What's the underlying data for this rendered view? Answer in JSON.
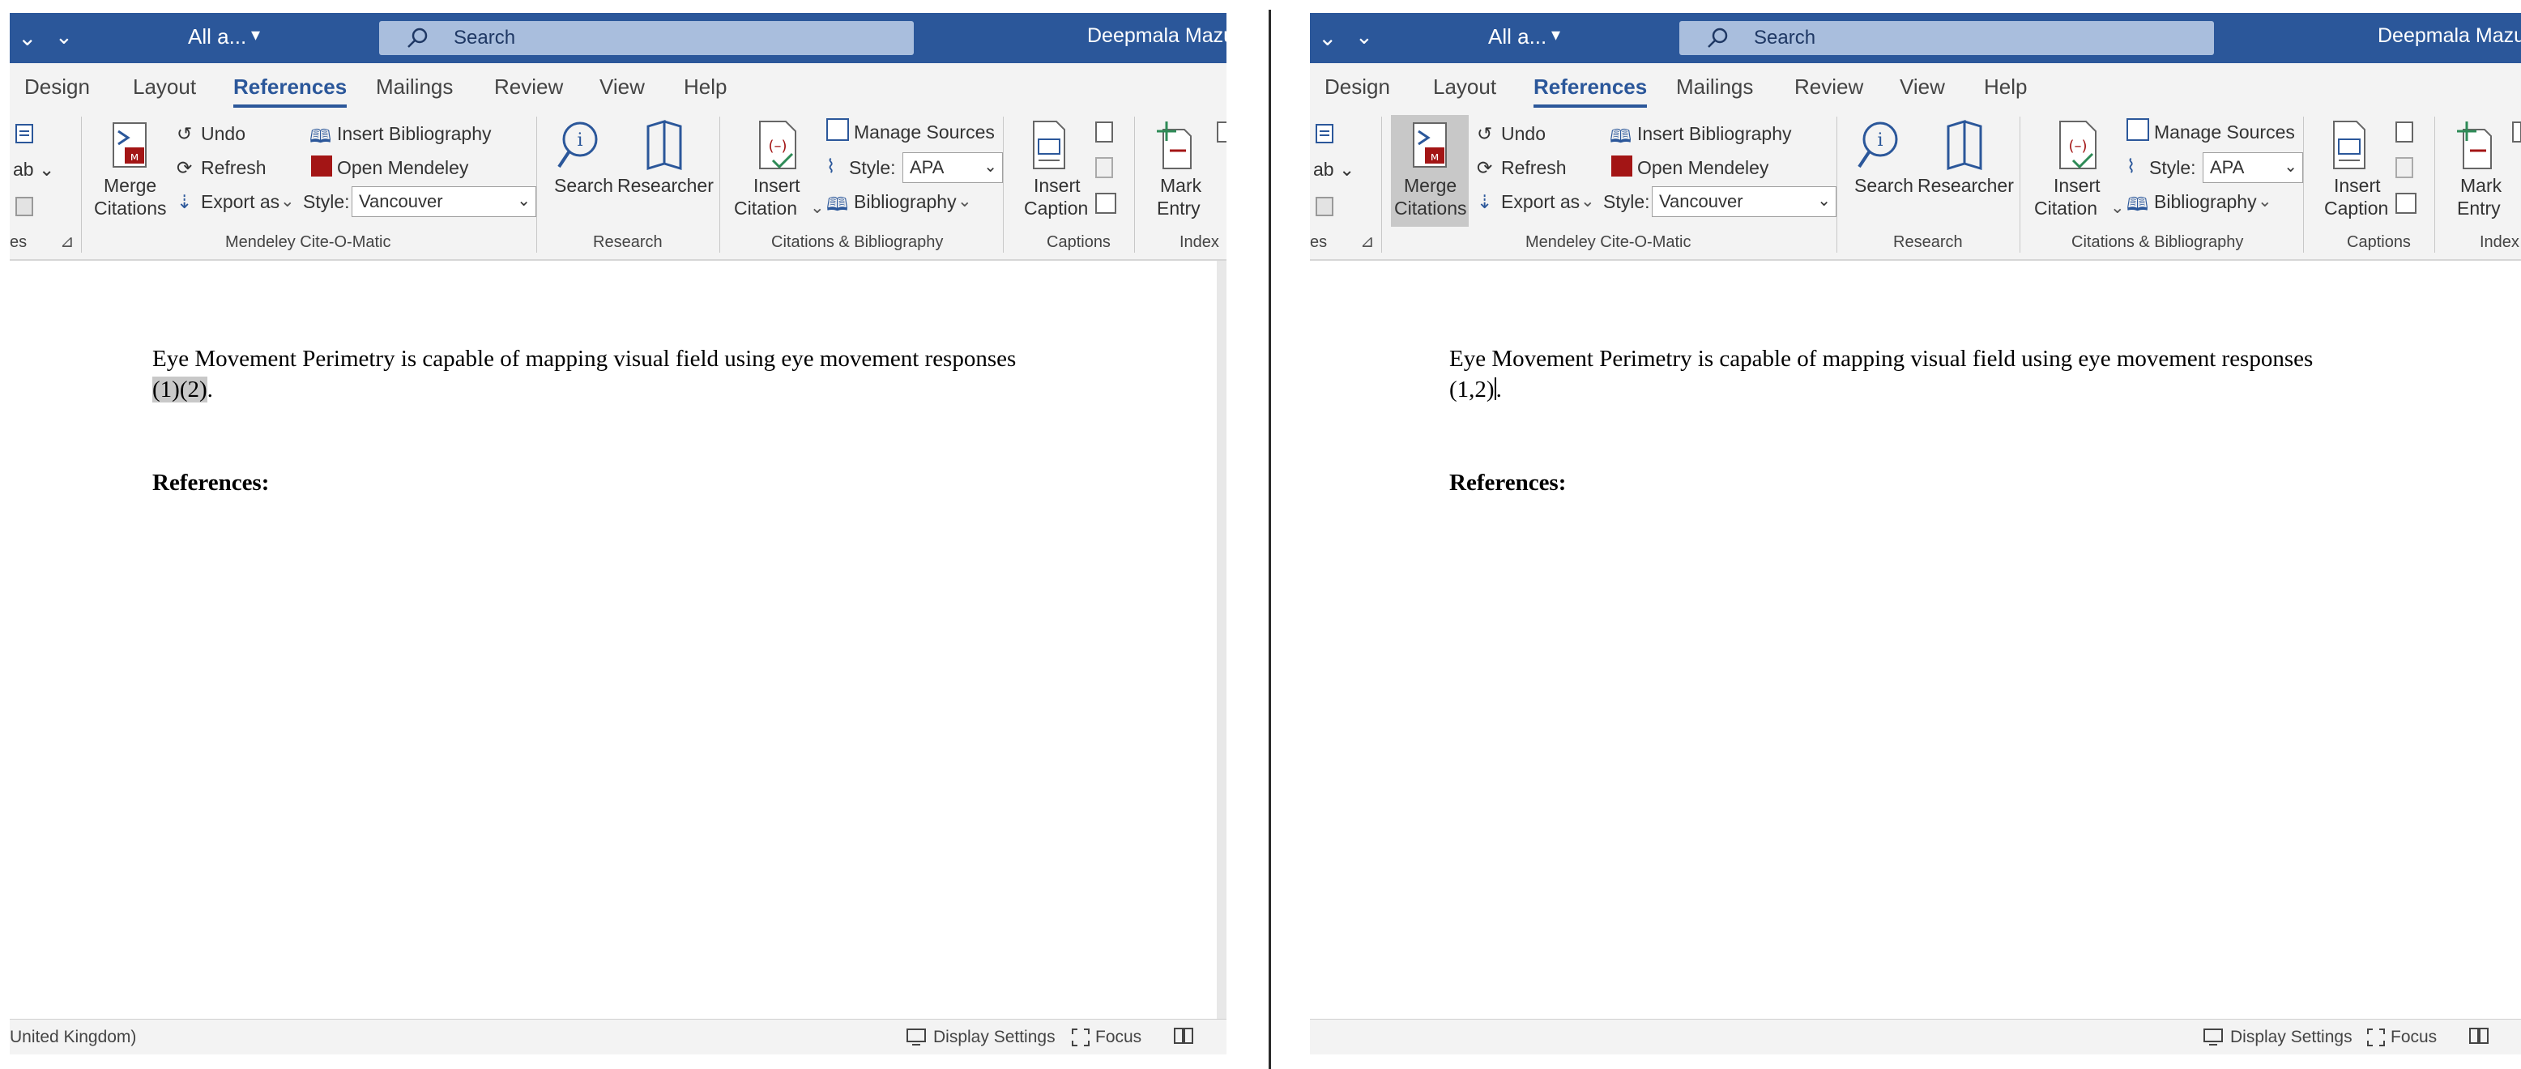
{
  "colors": {
    "titlebar": "#2b579a",
    "search_box": "#a9bedd",
    "ribbon": "#f3f3f3",
    "mendeley_red": "#a31515",
    "accent_blue": "#2b579a"
  },
  "left": {
    "titlebar": {
      "doc_label": "All a...",
      "search_placeholder": "Search",
      "user": "Deepmala Mazum"
    },
    "tabs": [
      "Design",
      "Layout",
      "References",
      "Mailings",
      "Review",
      "View",
      "Help"
    ],
    "active_tab": "References",
    "ribbon": {
      "cut_group_label": "es",
      "merge_citations": [
        "Merge",
        "Citations"
      ],
      "undo": "Undo",
      "refresh": "Refresh",
      "export_as": "Export as",
      "insert_bibliography": "Insert Bibliography",
      "open_mendeley": "Open Mendeley",
      "style_label": "Style:",
      "style_value": "Vancouver",
      "mendeley_group": "Mendeley Cite-O-Matic",
      "search": "Search",
      "researcher": "Researcher",
      "research_group": "Research",
      "insert_citation": [
        "Insert",
        "Citation"
      ],
      "manage_sources": "Manage Sources",
      "apa_style_label": "Style:",
      "apa_style_value": "APA",
      "bibliography": "Bibliography",
      "citations_group": "Citations & Bibliography",
      "insert_caption": [
        "Insert",
        "Caption"
      ],
      "captions_group": "Captions",
      "mark_entry": [
        "Mark",
        "Entry"
      ],
      "index_group": "Index"
    },
    "document": {
      "text_line1": "Eye Movement Perimetry is capable of mapping visual field using eye movement responses",
      "citation": "(1)(2)",
      "after_citation": ".",
      "references_heading": "References:"
    },
    "statusbar": {
      "language": "United Kingdom)",
      "display_settings": "Display Settings",
      "focus": "Focus"
    }
  },
  "right": {
    "titlebar": {
      "doc_label": "All a...",
      "search_placeholder": "Search",
      "user": "Deepmala Mazum"
    },
    "tabs": [
      "Design",
      "Layout",
      "References",
      "Mailings",
      "Review",
      "View",
      "Help"
    ],
    "active_tab": "References",
    "ribbon": {
      "cut_group_label": "es",
      "merge_citations": [
        "Merge",
        "Citations"
      ],
      "undo": "Undo",
      "refresh": "Refresh",
      "export_as": "Export as",
      "insert_bibliography": "Insert Bibliography",
      "open_mendeley": "Open Mendeley",
      "style_label": "Style:",
      "style_value": "Vancouver",
      "mendeley_group": "Mendeley Cite-O-Matic",
      "search": "Search",
      "researcher": "Researcher",
      "research_group": "Research",
      "insert_citation": [
        "Insert",
        "Citation"
      ],
      "manage_sources": "Manage Sources",
      "apa_style_label": "Style:",
      "apa_style_value": "APA",
      "bibliography": "Bibliography",
      "citations_group": "Citations & Bibliography",
      "insert_caption": [
        "Insert",
        "Caption"
      ],
      "captions_group": "Captions",
      "mark_entry": [
        "Mark",
        "Entry"
      ],
      "index_group": "Index"
    },
    "document": {
      "text_line1": "Eye Movement Perimetry is capable of mapping visual field using eye movement responses",
      "citation": "(1,2)",
      "after_citation": ".",
      "references_heading": "References:"
    },
    "statusbar": {
      "display_settings": "Display Settings",
      "focus": "Focus"
    }
  }
}
